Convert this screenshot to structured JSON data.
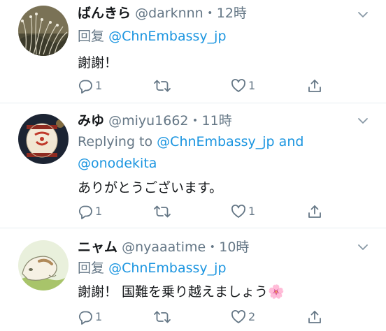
{
  "tweets": [
    {
      "name": "ばんきら",
      "handle": "@darknnn",
      "sep": "・",
      "time": "12時",
      "reply_prefix": "回复",
      "reply_to": "@ChnEmbassy_jp",
      "text": "謝謝！",
      "reply_count": "1",
      "retweet_count": "",
      "like_count": "1"
    },
    {
      "name": "みゆ",
      "handle": "@miyu1662",
      "sep": "・",
      "time": "11時",
      "reply_prefix": "Replying to",
      "reply_to": "@ChnEmbassy_jp",
      "reply_and": "and",
      "reply_to_2": "@onodekita",
      "text": "ありがとうございます。",
      "reply_count": "1",
      "retweet_count": "",
      "like_count": "1"
    },
    {
      "name": "ニャム",
      "handle": "@nyaaatime",
      "sep": "・",
      "time": "10時",
      "reply_prefix": "回复",
      "reply_to": "@ChnEmbassy_jp",
      "text": "謝謝！ 国難を乗り越えましょう",
      "emoji": "🌸",
      "reply_count": "1",
      "retweet_count": "",
      "like_count": "2"
    }
  ],
  "icons": {
    "reply": "reply-icon",
    "retweet": "retweet-icon",
    "like": "heart-icon",
    "share": "share-icon",
    "more": "chevron-down-icon"
  },
  "colors": {
    "link": "#1b95e0",
    "secondary": "#657786",
    "text": "#14171a",
    "divider": "#e6ecf0"
  }
}
